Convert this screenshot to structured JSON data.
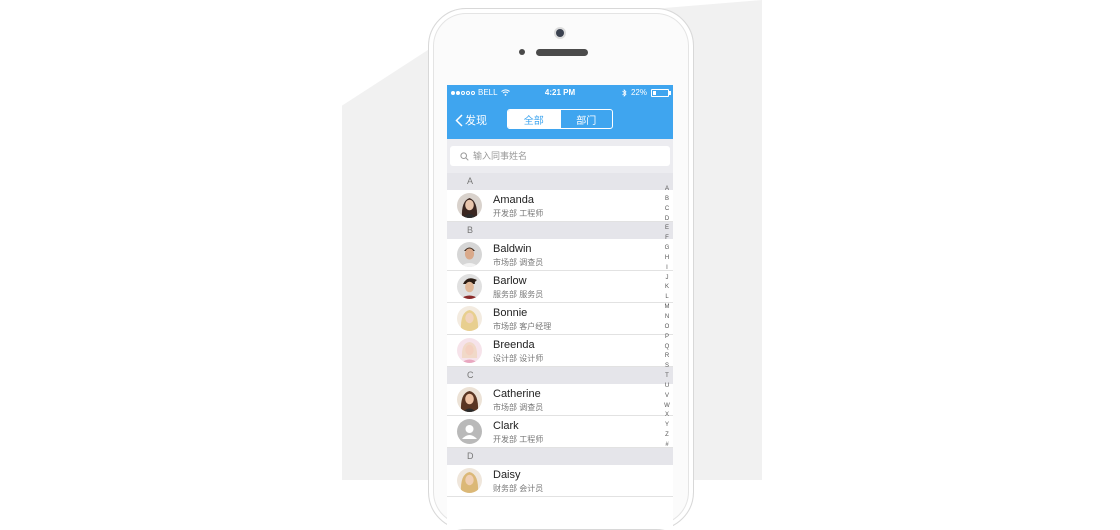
{
  "statusbar": {
    "carrier": "BELL",
    "time": "4:21 PM",
    "battery": "22%"
  },
  "nav": {
    "back_label": "发现",
    "tabs": [
      "全部",
      "部门"
    ],
    "active_tab": 0
  },
  "search": {
    "placeholder": "输入同事姓名"
  },
  "sections": [
    {
      "letter": "A",
      "contacts": [
        {
          "name": "Amanda",
          "dept": "开发部 工程师",
          "avatar": "woman-dark-hair"
        }
      ]
    },
    {
      "letter": "B",
      "contacts": [
        {
          "name": "Baldwin",
          "dept": "市场部 调查员",
          "avatar": "man-dark-hair"
        },
        {
          "name": "Barlow",
          "dept": "服务部 服务员",
          "avatar": "man-styled-hair"
        },
        {
          "name": "Bonnie",
          "dept": "市场部 客户经理",
          "avatar": "woman-blonde"
        },
        {
          "name": "Breenda",
          "dept": "设计部 设计师",
          "avatar": "woman-pink"
        }
      ]
    },
    {
      "letter": "C",
      "contacts": [
        {
          "name": "Catherine",
          "dept": "市场部 调查员",
          "avatar": "woman-brown-hair"
        },
        {
          "name": "Clark",
          "dept": "开发部 工程师",
          "avatar": "default-person"
        }
      ]
    },
    {
      "letter": "D",
      "contacts": [
        {
          "name": "Daisy",
          "dept": "财务部 会计员",
          "avatar": "woman-blonde"
        }
      ]
    }
  ],
  "index_letters": [
    "A",
    "B",
    "C",
    "D",
    "E",
    "F",
    "G",
    "H",
    "I",
    "J",
    "K",
    "L",
    "M",
    "N",
    "O",
    "P",
    "Q",
    "R",
    "S",
    "T",
    "U",
    "V",
    "W",
    "X",
    "Y",
    "Z",
    "#"
  ],
  "colors": {
    "accent": "#3fa5ef",
    "section_bg": "#e5e5ea"
  }
}
